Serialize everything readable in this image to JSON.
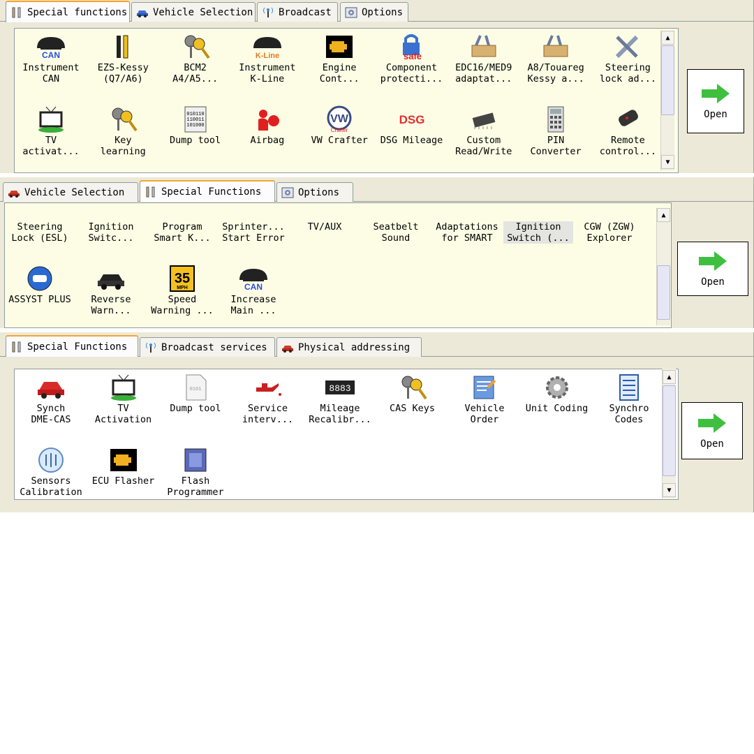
{
  "panel1": {
    "tabs": [
      "Special functions",
      "Vehicle Selection",
      "Broadcast",
      "Options"
    ],
    "items": [
      {
        "label": "Instrument\nCAN",
        "icon": "instrument-can-icon"
      },
      {
        "label": "EZS-Kessy\n(Q7/A6)",
        "icon": "key-tool-icon"
      },
      {
        "label": "BCM2\nA4/A5...",
        "icon": "keys-icon"
      },
      {
        "label": "Instrument\nK-Line",
        "icon": "instrument-kline-icon"
      },
      {
        "label": "Engine\nCont...",
        "icon": "engine-icon"
      },
      {
        "label": "Component\nprotecti...",
        "icon": "safe-lock-icon"
      },
      {
        "label": "EDC16/MED9\nadaptat...",
        "icon": "toolbox-icon"
      },
      {
        "label": "A8/Touareg\nKessy a...",
        "icon": "toolbox-icon"
      },
      {
        "label": "Steering\nlock ad...",
        "icon": "wrench-screwdriver-icon"
      },
      {
        "label": "TV\nactivat...",
        "icon": "tv-icon"
      },
      {
        "label": "Key\nlearning",
        "icon": "keys-icon"
      },
      {
        "label": "Dump tool",
        "icon": "binary-dump-icon"
      },
      {
        "label": "Airbag",
        "icon": "airbag-icon"
      },
      {
        "label": "VW Crafter",
        "icon": "vw-logo-icon"
      },
      {
        "label": "DSG Mileage",
        "icon": "dsg-icon"
      },
      {
        "label": "Custom\nRead/Write",
        "icon": "chip-icon"
      },
      {
        "label": "PIN\nConverter",
        "icon": "calculator-icon"
      },
      {
        "label": "Remote\ncontrol...",
        "icon": "remote-key-icon"
      }
    ],
    "open": "Open",
    "icon_text": {
      "can": "CAN",
      "kline": "K-Line",
      "safe": "safe",
      "dsg": "DSG",
      "crafter": "Crafter"
    }
  },
  "panel2": {
    "tabs": [
      "Vehicle Selection",
      "Special Functions",
      "Options"
    ],
    "items": [
      {
        "label": "Steering\nLock (ESL)"
      },
      {
        "label": "Ignition\nSwitc..."
      },
      {
        "label": "Program\nSmart K..."
      },
      {
        "label": "Sprinter...\nStart Error"
      },
      {
        "label": "TV/AUX"
      },
      {
        "label": "Seatbelt\nSound"
      },
      {
        "label": "Adaptations\nfor SMART"
      },
      {
        "label": "Ignition\nSwitch (...",
        "selected": true
      },
      {
        "label": "CGW (ZGW)\nExplorer"
      },
      {
        "label": "ASSYST PLUS",
        "icon": "assyst-icon"
      },
      {
        "label": "Reverse\nWarn...",
        "icon": "car-icon"
      },
      {
        "label": "Speed\nWarning ...",
        "icon": "speed-sign-icon"
      },
      {
        "label": "Increase\nMain ...",
        "icon": "instrument-can-icon"
      }
    ],
    "open": "Open",
    "icon_text": {
      "speed_value": "35",
      "speed_unit": "MPH",
      "can": "CAN"
    }
  },
  "panel3": {
    "tabs": [
      "Special Functions",
      "Broadcast services",
      "Physical addressing"
    ],
    "items": [
      {
        "label": "Synch\nDME-CAS",
        "icon": "red-car-icon"
      },
      {
        "label": "TV\nActivation",
        "icon": "tv-icon"
      },
      {
        "label": "Dump tool",
        "icon": "document-icon"
      },
      {
        "label": "Service\ninterv...",
        "icon": "oil-can-icon"
      },
      {
        "label": "Mileage\nRecalibr...",
        "icon": "odometer-icon"
      },
      {
        "label": "CAS Keys",
        "icon": "keys-icon"
      },
      {
        "label": "Vehicle\nOrder",
        "icon": "order-icon"
      },
      {
        "label": "Unit Coding",
        "icon": "gear-icon"
      },
      {
        "label": "Synchro\nCodes",
        "icon": "list-icon"
      },
      {
        "label": "Sensors\nCalibration",
        "icon": "sensors-icon"
      },
      {
        "label": "ECU Flasher",
        "icon": "engine-icon"
      },
      {
        "label": "Flash\nProgrammer",
        "icon": "flash-chip-icon"
      }
    ],
    "open": "Open",
    "icon_text": {
      "odometer": "8883"
    }
  },
  "colors": {
    "tab_accent": "#f6a42b",
    "grid_bg": "#fdfde6",
    "panel_bg": "#ece9d8",
    "open_arrow": "#3fbf3f"
  }
}
